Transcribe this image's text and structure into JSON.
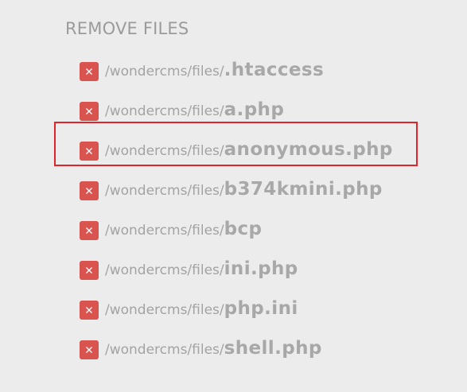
{
  "section": {
    "title": "REMOVE FILES"
  },
  "files": [
    {
      "prefix": "/wondercms/files/",
      "name": ".htaccess"
    },
    {
      "prefix": "/wondercms/files/",
      "name": "a.php"
    },
    {
      "prefix": "/wondercms/files/",
      "name": "anonymous.php"
    },
    {
      "prefix": "/wondercms/files/",
      "name": "b374kmini.php"
    },
    {
      "prefix": "/wondercms/files/",
      "name": "bcp"
    },
    {
      "prefix": "/wondercms/files/",
      "name": "ini.php"
    },
    {
      "prefix": "/wondercms/files/",
      "name": "php.ini"
    },
    {
      "prefix": "/wondercms/files/",
      "name": "shell.php"
    }
  ],
  "icons": {
    "remove": "close-icon"
  },
  "colors": {
    "background": "#ececec",
    "remove_button": "#d9534f",
    "highlight_border": "#e0242a",
    "text": "#a4a4a4"
  }
}
